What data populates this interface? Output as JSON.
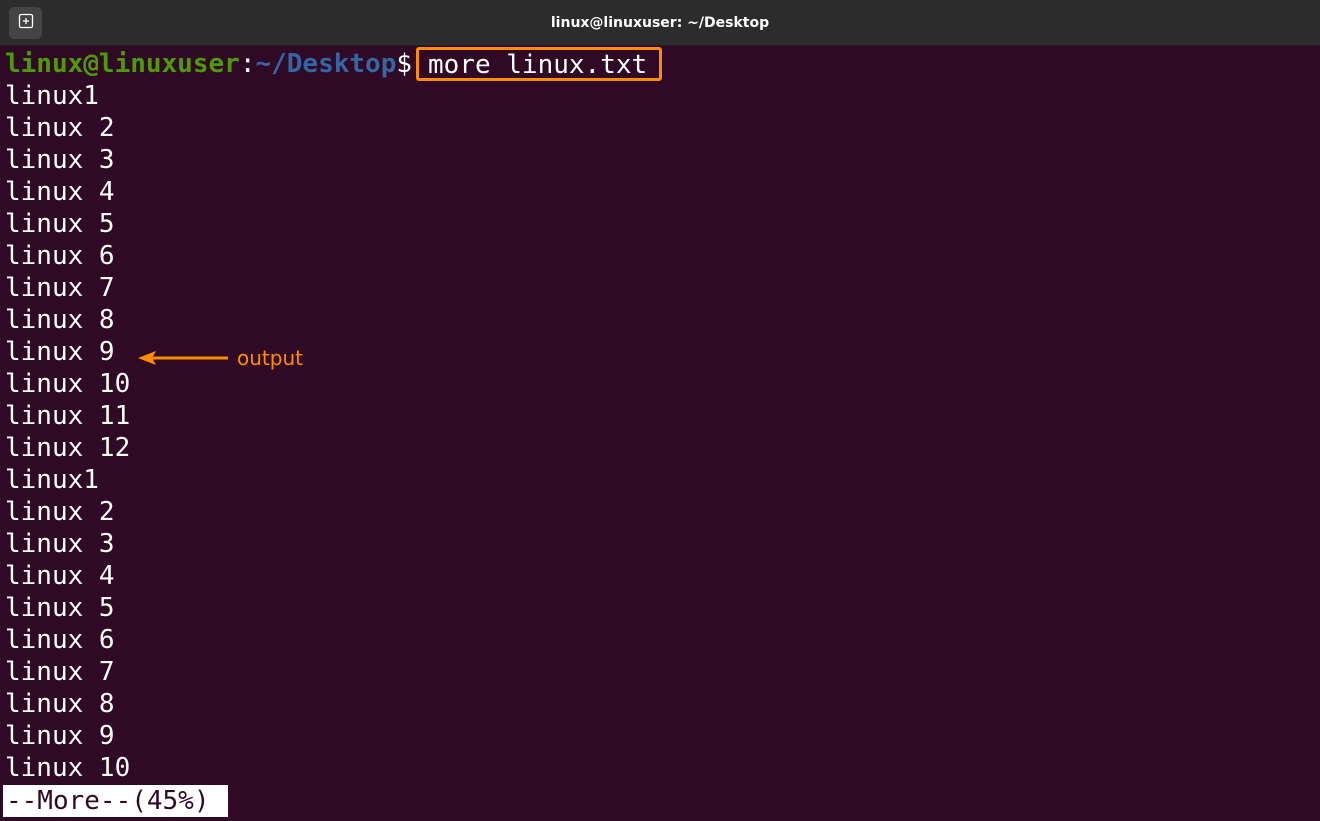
{
  "window": {
    "title": "linux@linuxuser: ~/Desktop",
    "new_tab_icon": "new-tab-icon"
  },
  "prompt": {
    "user_host": "linux@linuxuser",
    "colon": ":",
    "path": "~/Desktop",
    "dollar": "$",
    "command": "more linux.txt"
  },
  "output": [
    "linux1",
    "linux 2",
    "linux 3",
    "linux 4",
    "linux 5",
    "linux 6",
    "linux 7",
    "linux 8",
    "linux 9",
    "linux 10",
    "linux 11",
    "linux 12",
    "linux1",
    "linux 2",
    "linux 3",
    "linux 4",
    "linux 5",
    "linux 6",
    "linux 7",
    "linux 8",
    "linux 9",
    "linux 10"
  ],
  "pager_status": "--More--(45%)",
  "annotation": {
    "label": "output",
    "color": "#ff8c00"
  },
  "colors": {
    "background": "#300a24",
    "titlebar": "#2c2c2c",
    "prompt_user": "#4e9a06",
    "prompt_path": "#3465a4",
    "highlight": "#ff8c00"
  }
}
